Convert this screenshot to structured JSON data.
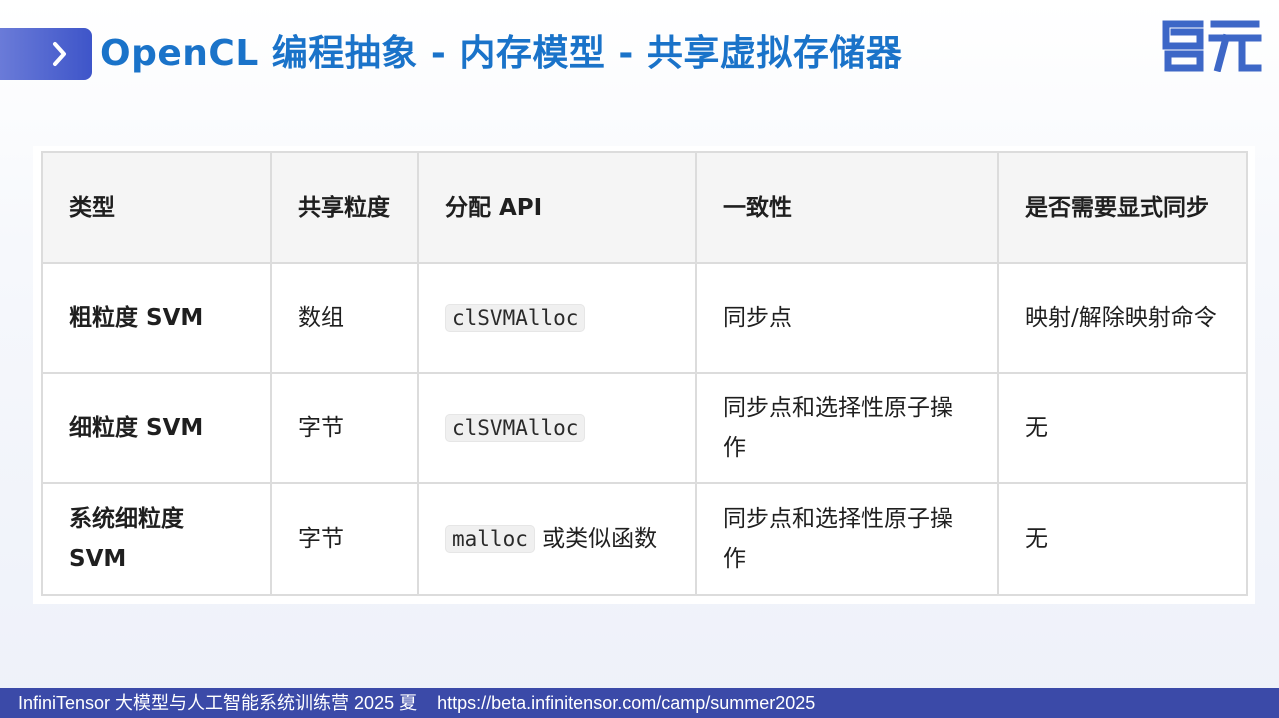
{
  "slide": {
    "title": "OpenCL 编程抽象 - 内存模型 - 共享虚拟存储器",
    "logo_text": "启元",
    "accent_color": "#1a73c9",
    "marker_color": "#3e55c9"
  },
  "table": {
    "headers": [
      "类型",
      "共享粒度",
      "分配 API",
      "一致性",
      "是否需要显式同步"
    ],
    "rows": [
      {
        "type": "粗粒度 SVM",
        "granularity": "数组",
        "api_code": "clSVMAlloc",
        "api_suffix": "",
        "consistency": "同步点",
        "explicit_sync": "映射/解除映射命令"
      },
      {
        "type": "细粒度 SVM",
        "granularity": "字节",
        "api_code": "clSVMAlloc",
        "api_suffix": "",
        "consistency": "同步点和选择性原子操作",
        "explicit_sync": "无"
      },
      {
        "type": "系统细粒度 SVM",
        "granularity": "字节",
        "api_code": "malloc",
        "api_suffix": " 或类似函数",
        "consistency": "同步点和选择性原子操作",
        "explicit_sync": "无"
      }
    ]
  },
  "footer": {
    "text": "InfiniTensor 大模型与人工智能系统训练营 2025 夏",
    "url": "https://beta.infinitensor.com/camp/summer2025",
    "bg_color": "#3b4aa8"
  }
}
